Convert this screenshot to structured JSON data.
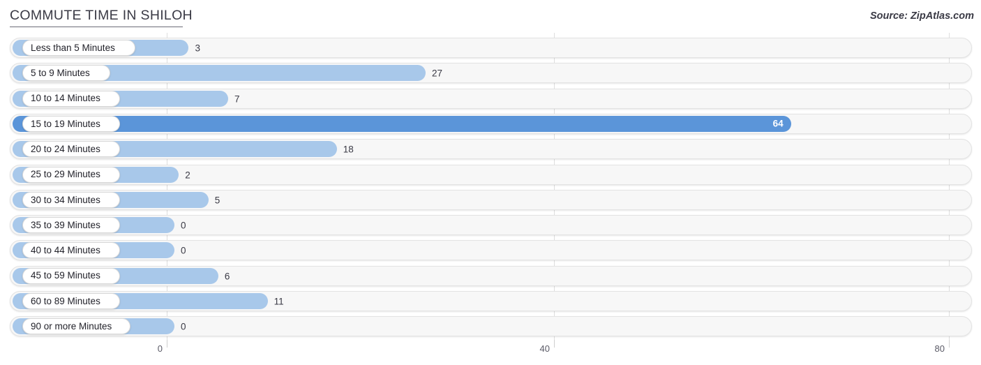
{
  "header": {
    "title": "COMMUTE TIME IN SHILOH",
    "source": "Source: ZipAtlas.com"
  },
  "colors": {
    "bar_normal": "#a8c8ea",
    "bar_highlight": "#5b95d9",
    "track": "#f7f7f7",
    "grid": "#dedede",
    "title_text": "#3a3a45"
  },
  "axis": {
    "ticks": [
      {
        "label": "0",
        "value": 0
      },
      {
        "label": "40",
        "value": 40
      },
      {
        "label": "80",
        "value": 80
      }
    ],
    "min": 0,
    "max": 80
  },
  "chart_data": {
    "type": "bar",
    "orientation": "horizontal",
    "title": "COMMUTE TIME IN SHILOH",
    "subtitle": "Source: ZipAtlas.com",
    "xlabel": "",
    "ylabel": "",
    "xlim": [
      0,
      80
    ],
    "grid": true,
    "legend": "none",
    "highlight_category": "15 to 19 Minutes",
    "categories": [
      "Less than 5 Minutes",
      "5 to 9 Minutes",
      "10 to 14 Minutes",
      "15 to 19 Minutes",
      "20 to 24 Minutes",
      "25 to 29 Minutes",
      "30 to 34 Minutes",
      "35 to 39 Minutes",
      "40 to 44 Minutes",
      "45 to 59 Minutes",
      "60 to 89 Minutes",
      "90 or more Minutes"
    ],
    "values": [
      3,
      27,
      7,
      64,
      18,
      2,
      5,
      0,
      0,
      6,
      11,
      0
    ]
  },
  "rows": [
    {
      "label": "Less than 5 Minutes",
      "value": 3,
      "value_label": "3",
      "highlight": false
    },
    {
      "label": "5 to 9 Minutes",
      "value": 27,
      "value_label": "27",
      "highlight": false
    },
    {
      "label": "10 to 14 Minutes",
      "value": 7,
      "value_label": "7",
      "highlight": false
    },
    {
      "label": "15 to 19 Minutes",
      "value": 64,
      "value_label": "64",
      "highlight": true
    },
    {
      "label": "20 to 24 Minutes",
      "value": 18,
      "value_label": "18",
      "highlight": false
    },
    {
      "label": "25 to 29 Minutes",
      "value": 2,
      "value_label": "2",
      "highlight": false
    },
    {
      "label": "30 to 34 Minutes",
      "value": 5,
      "value_label": "5",
      "highlight": false
    },
    {
      "label": "35 to 39 Minutes",
      "value": 0,
      "value_label": "0",
      "highlight": false
    },
    {
      "label": "40 to 44 Minutes",
      "value": 0,
      "value_label": "0",
      "highlight": false
    },
    {
      "label": "45 to 59 Minutes",
      "value": 6,
      "value_label": "6",
      "highlight": false
    },
    {
      "label": "60 to 89 Minutes",
      "value": 11,
      "value_label": "11",
      "highlight": false
    },
    {
      "label": "90 or more Minutes",
      "value": 0,
      "value_label": "0",
      "highlight": false
    }
  ]
}
